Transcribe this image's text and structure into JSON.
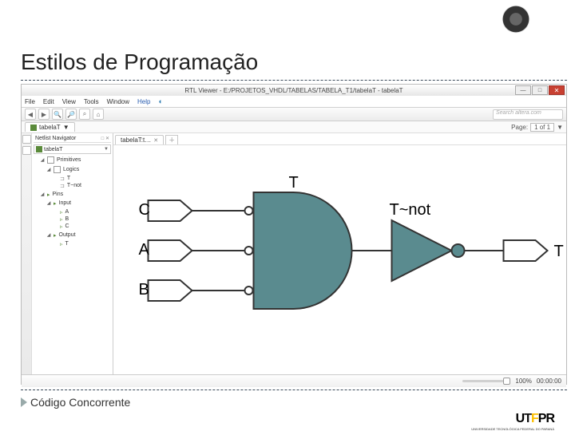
{
  "slide": {
    "title": "Estilos de Programação",
    "footer": "Código Concorrente",
    "brand_letters": {
      "u": "U",
      "t": "T",
      "f": "F",
      "p": "P",
      "r": "R"
    },
    "brand_sub": "UNIVERSIDADE TECNOLÓGICA FEDERAL DO PARANÁ"
  },
  "window": {
    "title": "RTL Viewer - E:/PROJETOS_VHDL/TABELAS/TABELA_T1/tabelaT - tabelaT",
    "menus": [
      "File",
      "Edit",
      "View",
      "Tools",
      "Window",
      "Help"
    ],
    "search_placeholder": "Search altera.com",
    "nav_panel_title": "Netlist Navigator",
    "pin_hint": "□ ✕",
    "dropdown": "tabelaT",
    "pages_label": "Page:",
    "pages_value": "1 of 1",
    "tree": {
      "primitives": "Primitives",
      "logics": "Logics",
      "t1": "T",
      "t2": "T~not",
      "pins": "Pins",
      "input": "Input",
      "a": "A",
      "b": "B",
      "c": "C",
      "output": "Output",
      "out_t": "T"
    },
    "canvas_tab": "tabelaT:t…",
    "status": {
      "zoom": "100%",
      "coords": "00:00:00"
    }
  },
  "schematic": {
    "inputs": [
      "C",
      "A",
      "B"
    ],
    "and_label": "T",
    "not_label": "T~not",
    "output": "T"
  }
}
